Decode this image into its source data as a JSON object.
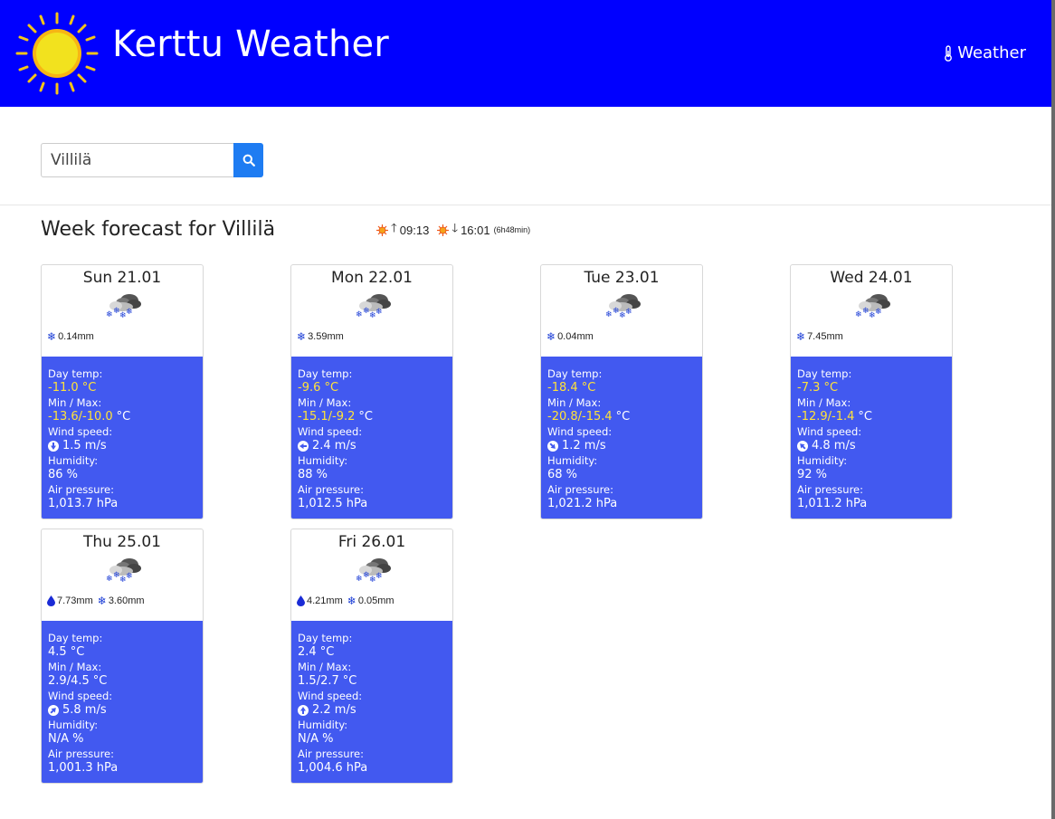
{
  "app": {
    "title": "Kerttu Weather",
    "nav_link": "Weather"
  },
  "search": {
    "value": "Villilä"
  },
  "forecast": {
    "title": "Week forecast for Villilä",
    "sunrise": "09:13",
    "sunset": "16:01",
    "daylength": "(6h48min)"
  },
  "days": [
    {
      "date": "Sun 21.01",
      "rain": "",
      "snow": "0.14mm",
      "day_temp": "-11.0 °C",
      "min": "-13.6",
      "max": "-10.0",
      "temp_unit": "°C",
      "yellow": true,
      "wind": "1.5 m/s",
      "humidity": "86 %",
      "pressure": "1,013.7 hPa",
      "wind_dir_deg": 180
    },
    {
      "date": "Mon 22.01",
      "rain": "",
      "snow": "3.59mm",
      "day_temp": "-9.6 °C",
      "min": "-15.1",
      "max": "-9.2",
      "temp_unit": "°C",
      "yellow": true,
      "wind": "2.4 m/s",
      "humidity": "88 %",
      "pressure": "1,012.5 hPa",
      "wind_dir_deg": 270
    },
    {
      "date": "Tue 23.01",
      "rain": "",
      "snow": "0.04mm",
      "day_temp": "-18.4 °C",
      "min": "-20.8",
      "max": "-15.4",
      "temp_unit": "°C",
      "yellow": true,
      "wind": "1.2 m/s",
      "humidity": "68 %",
      "pressure": "1,021.2 hPa",
      "wind_dir_deg": 135
    },
    {
      "date": "Wed 24.01",
      "rain": "",
      "snow": "7.45mm",
      "day_temp": "-7.3 °C",
      "min": "-12.9",
      "max": "-1.4",
      "temp_unit": "°C",
      "yellow": true,
      "wind": "4.8 m/s",
      "humidity": "92 %",
      "pressure": "1,011.2 hPa",
      "wind_dir_deg": 315
    },
    {
      "date": "Thu 25.01",
      "rain": "7.73mm",
      "snow": "3.60mm",
      "day_temp": "4.5 °C",
      "min": "2.9",
      "max": "4.5",
      "temp_unit": "°C",
      "yellow": false,
      "wind": "5.8 m/s",
      "humidity": "N/A %",
      "pressure": "1,001.3 hPa",
      "wind_dir_deg": 45
    },
    {
      "date": "Fri 26.01",
      "rain": "4.21mm",
      "snow": "0.05mm",
      "day_temp": "2.4 °C",
      "min": "1.5",
      "max": "2.7",
      "temp_unit": "°C",
      "yellow": false,
      "wind": "2.2 m/s",
      "humidity": "N/A %",
      "pressure": "1,004.6 hPa",
      "wind_dir_deg": 0
    }
  ],
  "labels": {
    "day_temp": "Day temp:",
    "min_max": "Min / Max:",
    "wind_speed": "Wind speed:",
    "humidity": "Humidity:",
    "air_pressure": "Air pressure:"
  },
  "colors": {
    "navbar": "#0000ff",
    "card_body": "#4259f0",
    "search_button": "#1e7cf2",
    "highlight": "#ffe23a"
  },
  "icons": {
    "logo": "sun-icon",
    "nav": "thermometer-icon",
    "search": "search-icon",
    "weather": "snow-cloud-icon",
    "snow": "snowflake-icon",
    "rain": "raindrop-icon",
    "wind": "wind-direction-icon"
  }
}
